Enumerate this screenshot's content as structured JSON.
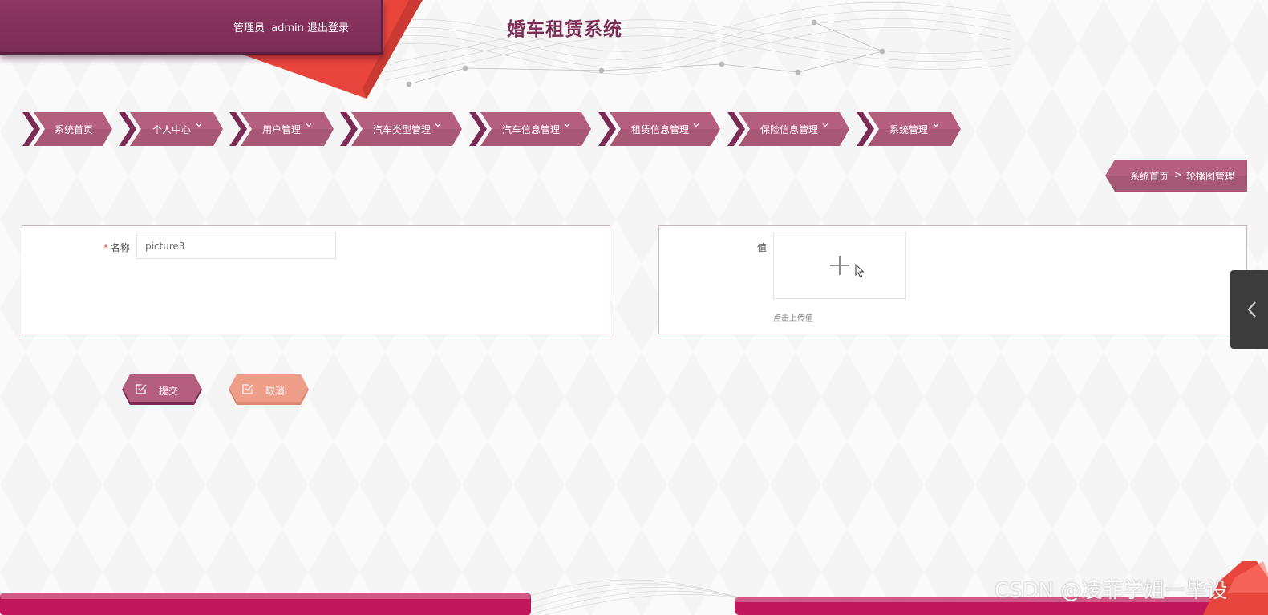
{
  "header": {
    "role_label": "管理员",
    "username": "admin",
    "logout_label": "退出登录",
    "app_title": "婚车租赁系统"
  },
  "nav": {
    "items": [
      {
        "label": "系统首页",
        "has_dropdown": false
      },
      {
        "label": "个人中心",
        "has_dropdown": true
      },
      {
        "label": "用户管理",
        "has_dropdown": true
      },
      {
        "label": "汽车类型管理",
        "has_dropdown": true
      },
      {
        "label": "汽车信息管理",
        "has_dropdown": true
      },
      {
        "label": "租赁信息管理",
        "has_dropdown": true
      },
      {
        "label": "保险信息管理",
        "has_dropdown": true
      },
      {
        "label": "系统管理",
        "has_dropdown": true
      }
    ],
    "chevron_icon": "chevron-down-icon"
  },
  "breadcrumb": {
    "home": "系统首页",
    "separator": ">",
    "current": "轮播图管理"
  },
  "form": {
    "name_label": "名称",
    "name_required_mark": "*",
    "name_value": "picture3",
    "value_label": "值",
    "upload_tip": "点击上传值",
    "upload_icon": "plus-icon"
  },
  "actions": {
    "submit_label": "提交",
    "cancel_label": "取消",
    "button_icon": "checkbox-edit-icon"
  },
  "watermark": "CSDN @凌菲学姐一毕设",
  "colors": {
    "primary": "#b55f7e",
    "primary_dark": "#7a2c55",
    "accent_red": "#e8453c",
    "cancel": "#ee9d88",
    "footer_pink": "#c2185b"
  }
}
